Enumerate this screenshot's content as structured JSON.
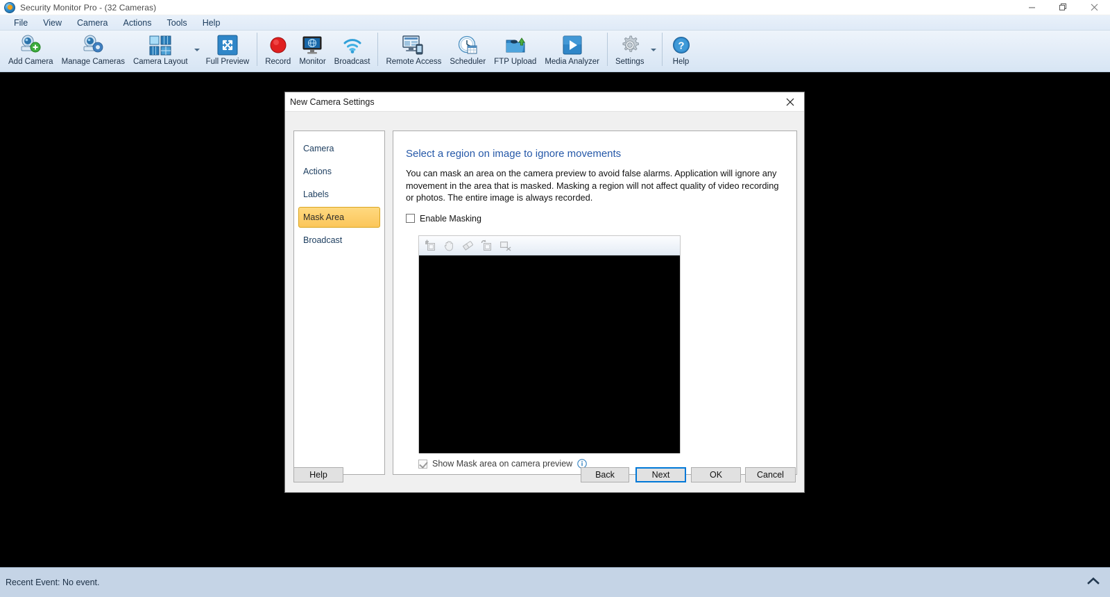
{
  "window": {
    "title": "Security Monitor Pro - (32 Cameras)",
    "app_icon": "camera-globe-icon",
    "controls": [
      {
        "name": "minimize-button",
        "glyph": "minimize-icon"
      },
      {
        "name": "restore-button",
        "glyph": "restore-icon"
      },
      {
        "name": "close-button",
        "glyph": "close-icon"
      }
    ]
  },
  "menubar": {
    "items": [
      {
        "label": "File"
      },
      {
        "label": "View"
      },
      {
        "label": "Camera"
      },
      {
        "label": "Actions"
      },
      {
        "label": "Tools"
      },
      {
        "label": "Help"
      }
    ]
  },
  "toolbar": {
    "buttons": [
      {
        "label": "Add Camera",
        "icon": "add-camera-icon"
      },
      {
        "label": "Manage Cameras",
        "icon": "manage-cameras-icon"
      },
      {
        "label": "Camera Layout",
        "icon": "camera-layout-icon",
        "has_dropdown": true
      },
      {
        "label": "Full Preview",
        "icon": "full-preview-icon"
      },
      {
        "label": "Record",
        "icon": "record-icon"
      },
      {
        "label": "Monitor",
        "icon": "monitor-icon"
      },
      {
        "label": "Broadcast",
        "icon": "broadcast-wifi-icon"
      },
      {
        "label": "Remote Access",
        "icon": "remote-access-icon"
      },
      {
        "label": "Scheduler",
        "icon": "scheduler-clock-icon"
      },
      {
        "label": "FTP Upload",
        "icon": "ftp-upload-icon"
      },
      {
        "label": "Media Analyzer",
        "icon": "media-analyzer-play-icon"
      },
      {
        "label": "Settings",
        "icon": "gear-icon",
        "has_dropdown": true
      },
      {
        "label": "Help",
        "icon": "help-question-icon"
      }
    ]
  },
  "dialog": {
    "title": "New Camera Settings",
    "close_label": "✕",
    "sidebar": {
      "items": [
        {
          "label": "Camera",
          "selected": false
        },
        {
          "label": "Actions",
          "selected": false
        },
        {
          "label": "Labels",
          "selected": false
        },
        {
          "label": "Mask Area",
          "selected": true
        },
        {
          "label": "Broadcast",
          "selected": false
        }
      ]
    },
    "panel": {
      "heading": "Select a region on image to ignore movements",
      "description": "You can mask an area on the camera preview to avoid false alarms. Application will ignore any movement in the area that is masked. Masking a region will not affect quality of video recording or photos. The entire image is always recorded.",
      "enable_masking": {
        "label": "Enable Masking",
        "checked": false
      },
      "editor_tools": [
        {
          "name": "add-region-tool",
          "icon": "add-region-icon"
        },
        {
          "name": "pan-tool",
          "icon": "hand-icon"
        },
        {
          "name": "eraser-tool",
          "icon": "eraser-icon"
        },
        {
          "name": "move-region-tool",
          "icon": "move-region-icon"
        },
        {
          "name": "cut-region-tool",
          "icon": "cut-region-icon"
        }
      ],
      "show_mask": {
        "label": "Show Mask area on camera preview",
        "checked": true,
        "disabled": true,
        "info_icon": "info-icon"
      }
    },
    "buttons": {
      "help": "Help",
      "back": "Back",
      "next": "Next",
      "ok": "OK",
      "cancel": "Cancel",
      "focused": "Next"
    }
  },
  "statusbar": {
    "text": "Recent Event: No event.",
    "chevron": "chevron-up-icon"
  },
  "colors": {
    "accent_blue": "#2558a8",
    "focus_blue": "#0078d7",
    "selection_amber": "#fbc65a",
    "status_bg": "#c5d4e6"
  }
}
